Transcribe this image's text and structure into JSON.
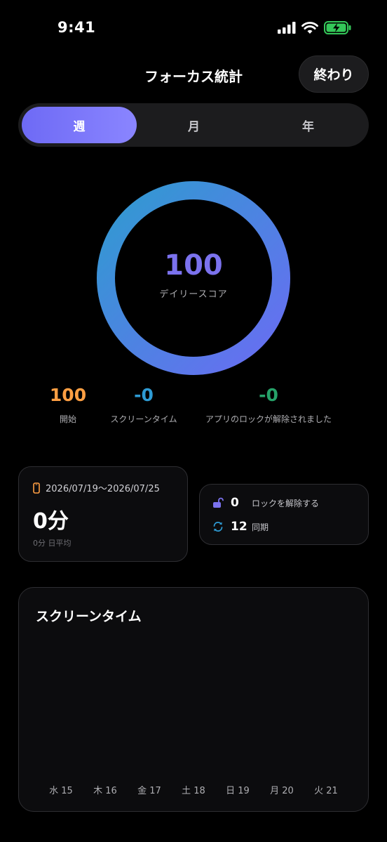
{
  "status_bar": {
    "time": "9:41"
  },
  "header": {
    "title": "フォーカス統計",
    "done_label": "終わり"
  },
  "tabs": [
    {
      "label": "週",
      "active": true
    },
    {
      "label": "月",
      "active": false
    },
    {
      "label": "年",
      "active": false
    }
  ],
  "score": {
    "value": "100",
    "label": "デイリースコア",
    "progress": 1.0
  },
  "stats": [
    {
      "value": "100",
      "label": "開始",
      "color": "#ff9f43"
    },
    {
      "value": "-0",
      "label": "スクリーンタイム",
      "color": "#2e9bd4"
    },
    {
      "value": "-0",
      "label": "アプリのロックが解除されました",
      "color": "#26a269"
    }
  ],
  "summary_card": {
    "date_range": "2026/07/19～2026/07/25",
    "total": "0分",
    "average": "0分 日平均"
  },
  "lock_card": {
    "unlock_count": "0",
    "unlock_label": "ロックを解除する",
    "sync_count": "12",
    "sync_label": "同期"
  },
  "chart_data": {
    "type": "bar",
    "title": "スクリーンタイム",
    "categories": [
      "水 15",
      "木 16",
      "金 17",
      "土 18",
      "日 19",
      "月 20",
      "火 21"
    ],
    "values": [
      0,
      0,
      0,
      0,
      0,
      0,
      0
    ]
  },
  "colors": {
    "accent": "#6e6af5",
    "ring_start": "#2f9bd0",
    "ring_end": "#6a6cf3",
    "orange": "#ff9f43",
    "blue": "#2e9bd4",
    "green": "#26a269"
  }
}
